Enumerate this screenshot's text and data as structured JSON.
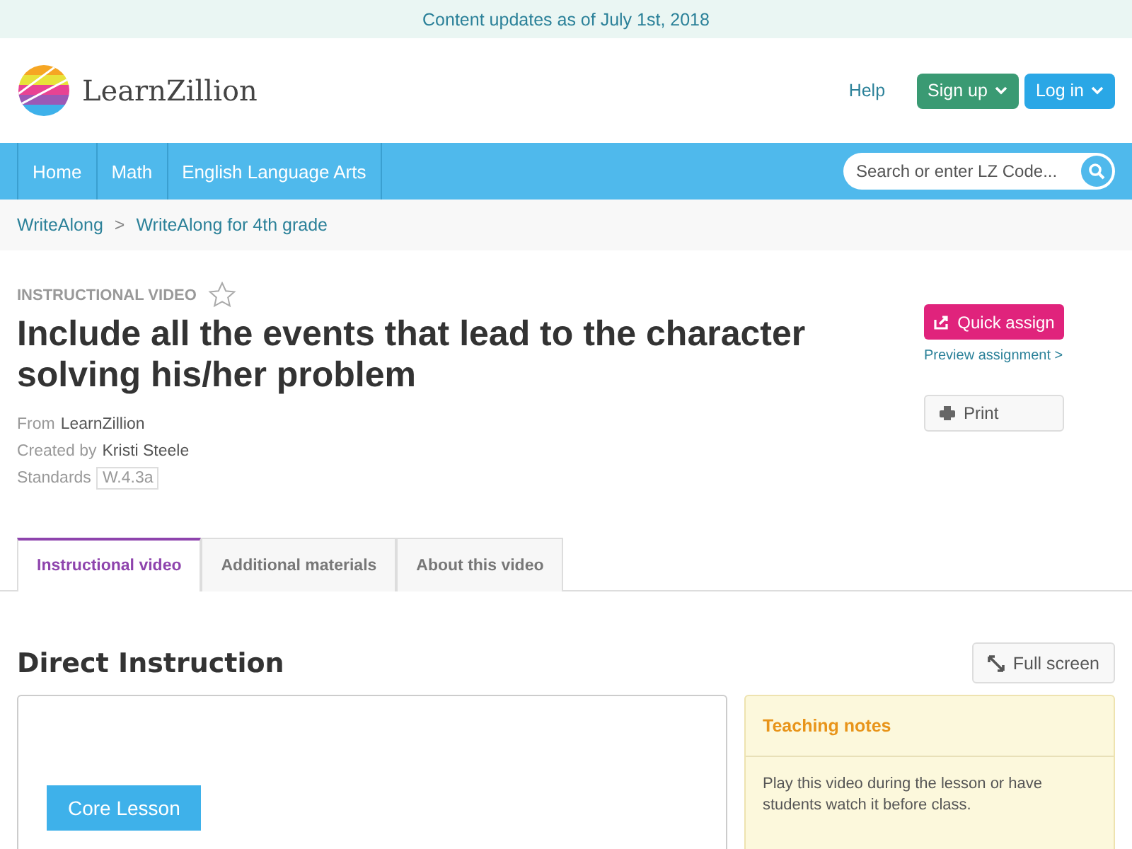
{
  "banner": {
    "text": "Content updates as of July 1st, 2018"
  },
  "header": {
    "logo_text": "LearnZillion",
    "help": "Help",
    "signup": "Sign up",
    "login": "Log in"
  },
  "nav": {
    "items": [
      {
        "label": "Home"
      },
      {
        "label": "Math"
      },
      {
        "label": "English Language Arts"
      }
    ],
    "search": {
      "placeholder": "Search or enter LZ Code..."
    }
  },
  "breadcrumbs": [
    {
      "label": "WriteAlong"
    },
    {
      "label": "WriteAlong for 4th grade"
    }
  ],
  "breadcrumb_separator": ">",
  "lesson": {
    "type_label": "INSTRUCTIONAL VIDEO",
    "favorited": false,
    "title": "Include all the events that lead to the character solving his/her problem",
    "meta": [
      {
        "label": "From",
        "value": "LearnZillion",
        "kind": "text"
      },
      {
        "label": "Created by",
        "value": "Kristi Steele",
        "kind": "text"
      },
      {
        "label": "Standards",
        "value": "W.4.3a",
        "kind": "tag"
      }
    ],
    "quick_assign": "Quick assign",
    "preview": "Preview assignment >",
    "print": "Print"
  },
  "tabs": [
    {
      "label": "Instructional video",
      "selected": true
    },
    {
      "label": "Additional materials",
      "selected": false
    },
    {
      "label": "About this video",
      "selected": false
    }
  ],
  "section": {
    "title": "Direct Instruction",
    "fullscreen": "Full screen"
  },
  "video": {
    "slide_label": "Core Lesson"
  },
  "notes": {
    "title": "Teaching notes",
    "text": "Play this video during the lesson or have students watch it before class."
  }
}
